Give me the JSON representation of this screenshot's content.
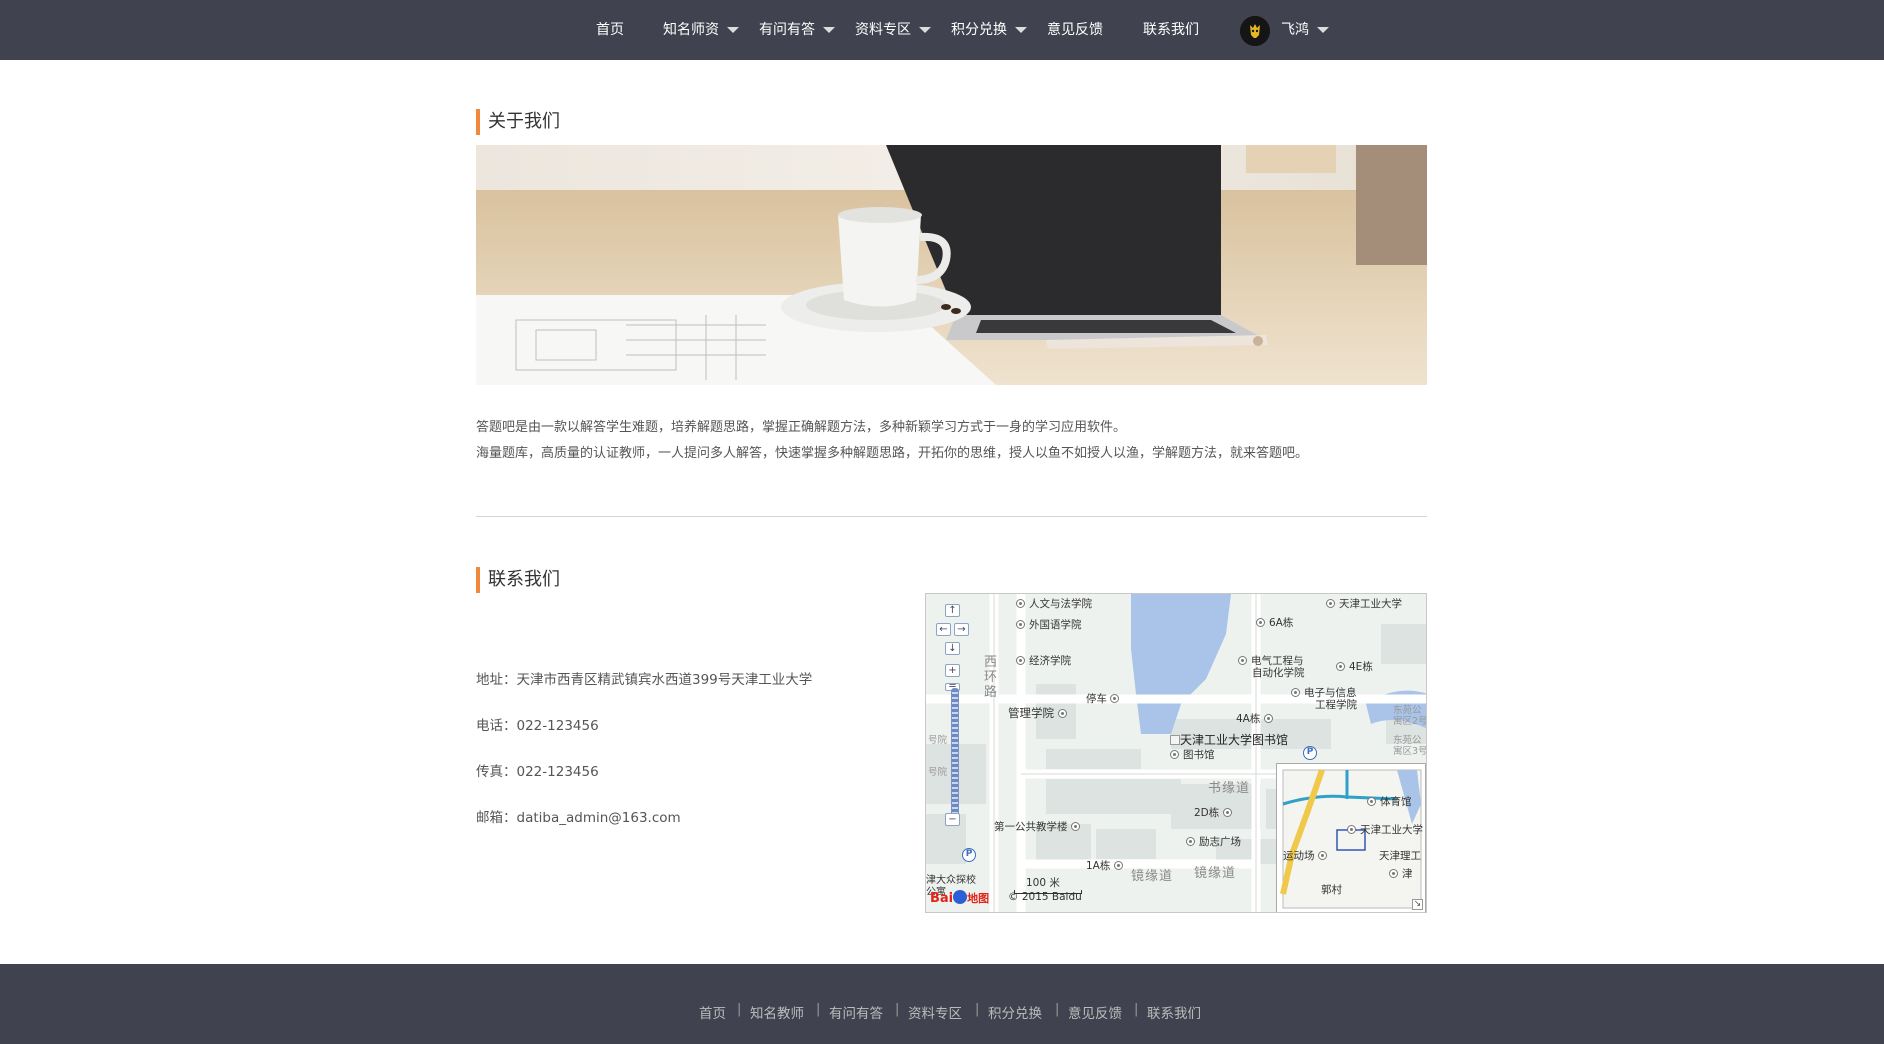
{
  "nav": {
    "items": [
      {
        "label": "首页",
        "dropdown": false
      },
      {
        "label": "知名师资",
        "dropdown": true
      },
      {
        "label": "有问有答",
        "dropdown": true
      },
      {
        "label": "资料专区",
        "dropdown": true
      },
      {
        "label": "积分兑换",
        "dropdown": true
      },
      {
        "label": "意见反馈",
        "dropdown": false
      },
      {
        "label": "联系我们",
        "dropdown": false
      }
    ],
    "user": {
      "name": "飞鸿",
      "avatar_icon": "user-avatar-icon"
    }
  },
  "about": {
    "title": "关于我们",
    "hero_alt": "laptop-coffee-desk-photo",
    "paragraphs": [
      "答题吧是由一款以解答学生难题，培养解题思路，掌握正确解题方法，多种新颖学习方式于一身的学习应用软件。",
      "海量题库，高质量的认证教师，一人提问多人解答，快速掌握多种解题思路，开拓你的思维，授人以鱼不如授人以渔，学解题方法，就来答题吧。"
    ]
  },
  "contact": {
    "title": "联系我们",
    "address": "地址：天津市西青区精武镇宾水西道399号天津工业大学",
    "phone": "电话：022-123456",
    "fax": "传真：022-123456",
    "email": "邮箱：datiba_admin@163.com"
  },
  "map": {
    "marker_label": "天津工业大学图书馆",
    "pois": [
      "人文与法学院",
      "外国语学院",
      "经济学院",
      "管理学院",
      "停车",
      "天津工业大学",
      "6A栋",
      "电气工程与",
      "自动化学院",
      "4E栋",
      "电子与信息",
      "工程学院",
      "4A栋",
      "图书馆",
      "2D栋",
      "第一公共教学楼",
      "励志广场",
      "1A栋"
    ],
    "roads": [
      "西",
      "环",
      "路",
      "书缘道",
      "镜缘道",
      "镜缘道"
    ],
    "edge_labels": [
      "东苑公",
      "寓区2号",
      "东苑公",
      "寓区3号",
      "号院",
      "号院",
      "津大众探校",
      "公寓"
    ],
    "scale": "100 米",
    "copyright": "© 2015 Baidu",
    "logo_text": "Bai",
    "logo_suffix": "地图",
    "minimap_labels": [
      "体育馆",
      "天津工业大学",
      "运动场",
      "天津理工",
      "津",
      "郭村"
    ]
  },
  "footer": {
    "links": [
      "首页",
      "知名教师",
      "有问有答",
      "资料专区",
      "积分兑换",
      "意见反馈",
      "联系我们"
    ],
    "separator": "|"
  },
  "colors": {
    "nav_bg": "#40434f",
    "accent": "#f0883e",
    "footer_bg": "#40434f",
    "map_water": "#a9c4e8"
  }
}
